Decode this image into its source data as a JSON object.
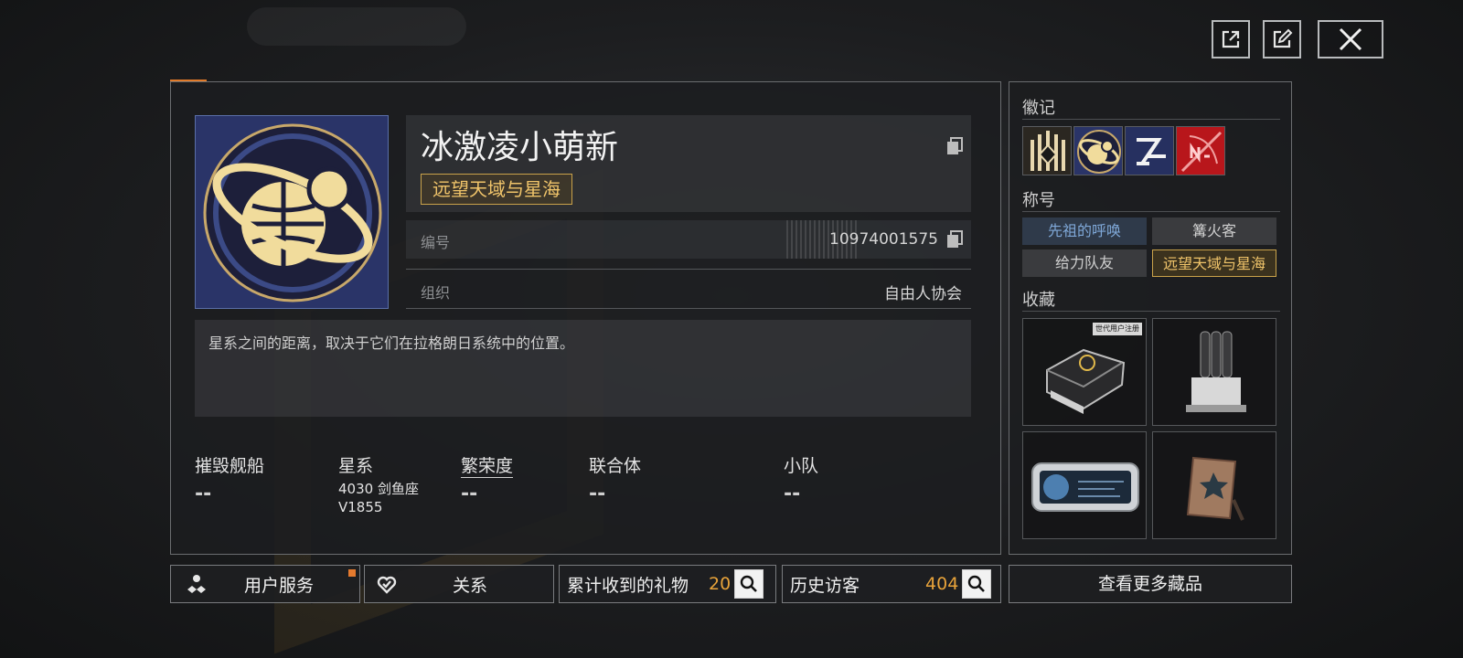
{
  "profile": {
    "name": "冰激凌小萌新",
    "active_title": "远望天域与星海",
    "id_label": "编号",
    "id_value": "10974001575",
    "org_label": "组织",
    "org_value": "自由人协会",
    "description": "星系之间的距离，取决于它们在拉格朗日系统中的位置。"
  },
  "stats": [
    {
      "label": "摧毁舰船",
      "value": "--"
    },
    {
      "label": "星系",
      "value_line1": "4030 剑鱼座",
      "value_line2": "V1855"
    },
    {
      "label": "繁荣度",
      "value": "--"
    },
    {
      "label": "联合体",
      "value": "--"
    },
    {
      "label": "小队",
      "value": "--"
    }
  ],
  "bottom_bar": {
    "user_service": "用户服务",
    "relations": "关系",
    "gifts_label": "累计收到的礼物",
    "gifts_count": "20",
    "visitors_label": "历史访客",
    "visitors_count": "404"
  },
  "sidebar": {
    "emblems_title": "徽记",
    "titles_title": "称号",
    "titles": [
      "先祖的呼唤",
      "篝火客",
      "给力队友",
      "远望天域与星海"
    ],
    "collection_title": "收藏",
    "collection_badge_text": "世代用户注册",
    "more_button": "查看更多藏品"
  },
  "colors": {
    "accent_orange": "#e07a2a",
    "gold": "#f0c46a",
    "count_orange": "#e8a33a"
  },
  "icons": [
    "share-icon",
    "edit-icon",
    "close-icon",
    "copy-icon",
    "service-icon",
    "relation-icon",
    "search-icon"
  ]
}
